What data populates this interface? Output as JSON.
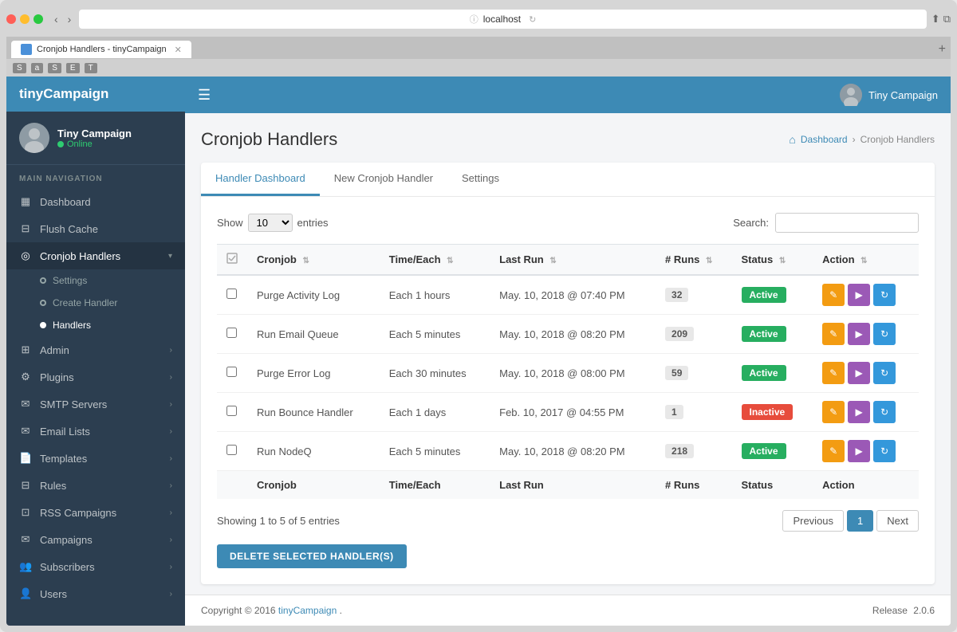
{
  "browser": {
    "url": "localhost",
    "tab_title": "Cronjob Handlers - tinyCampaign",
    "tab_label": "Cronjob Handlers - tinyCampaign"
  },
  "sidebar": {
    "logo_prefix": "tiny",
    "logo_suffix": "Campaign",
    "user": {
      "name": "Tiny Campaign",
      "status": "Online"
    },
    "nav_label": "Main Navigation",
    "items": [
      {
        "id": "dashboard",
        "icon": "▦",
        "label": "Dashboard"
      },
      {
        "id": "flush-cache",
        "icon": "⊟",
        "label": "Flush Cache"
      },
      {
        "id": "cronjob-handlers",
        "icon": "◎",
        "label": "Cronjob Handlers",
        "active": true,
        "has_arrow": true
      },
      {
        "id": "admin",
        "icon": "⊞",
        "label": "Admin",
        "has_arrow": true
      },
      {
        "id": "plugins",
        "icon": "⚙",
        "label": "Plugins",
        "has_arrow": true
      },
      {
        "id": "smtp-servers",
        "icon": "✉",
        "label": "SMTP Servers",
        "has_arrow": true
      },
      {
        "id": "email-lists",
        "icon": "✉",
        "label": "Email Lists",
        "has_arrow": true
      },
      {
        "id": "templates",
        "icon": "📄",
        "label": "Templates",
        "has_arrow": true
      },
      {
        "id": "rules",
        "icon": "⊟",
        "label": "Rules",
        "has_arrow": true
      },
      {
        "id": "rss-campaigns",
        "icon": "⊡",
        "label": "RSS Campaigns",
        "has_arrow": true
      },
      {
        "id": "campaigns",
        "icon": "✉",
        "label": "Campaigns",
        "has_arrow": true
      },
      {
        "id": "subscribers",
        "icon": "👥",
        "label": "Subscribers",
        "has_arrow": true
      },
      {
        "id": "users",
        "icon": "👤",
        "label": "Users",
        "has_arrow": true
      }
    ],
    "sub_items": [
      {
        "id": "settings",
        "label": "Settings",
        "filled": false
      },
      {
        "id": "create-handler",
        "label": "Create Handler",
        "filled": false
      },
      {
        "id": "handlers",
        "label": "Handlers",
        "active": true,
        "filled": true
      }
    ]
  },
  "topbar": {
    "user_name": "Tiny Campaign"
  },
  "page": {
    "title": "Cronjob Handlers",
    "breadcrumb": {
      "home": "Dashboard",
      "current": "Cronjob Handlers"
    },
    "tabs": [
      {
        "id": "handler-dashboard",
        "label": "Handler Dashboard",
        "active": true
      },
      {
        "id": "new-cronjob-handler",
        "label": "New Cronjob Handler",
        "active": false
      },
      {
        "id": "settings",
        "label": "Settings",
        "active": false
      }
    ],
    "table": {
      "show_label": "Show",
      "entries_label": "entries",
      "search_label": "Search:",
      "show_value": "10",
      "columns": [
        {
          "id": "cronjob",
          "label": "Cronjob"
        },
        {
          "id": "time-each",
          "label": "Time/Each"
        },
        {
          "id": "last-run",
          "label": "Last Run"
        },
        {
          "id": "num-runs",
          "label": "# Runs"
        },
        {
          "id": "status",
          "label": "Status"
        },
        {
          "id": "action",
          "label": "Action"
        }
      ],
      "rows": [
        {
          "id": "row1",
          "cronjob": "Purge Activity Log",
          "time_each": "Each 1 hours",
          "last_run": "May. 10, 2018 @ 07:40 PM",
          "num_runs": "32",
          "status": "Active",
          "status_type": "active"
        },
        {
          "id": "row2",
          "cronjob": "Run Email Queue",
          "time_each": "Each 5 minutes",
          "last_run": "May. 10, 2018 @ 08:20 PM",
          "num_runs": "209",
          "status": "Active",
          "status_type": "active"
        },
        {
          "id": "row3",
          "cronjob": "Purge Error Log",
          "time_each": "Each 30 minutes",
          "last_run": "May. 10, 2018 @ 08:00 PM",
          "num_runs": "59",
          "status": "Active",
          "status_type": "active"
        },
        {
          "id": "row4",
          "cronjob": "Run Bounce Handler",
          "time_each": "Each 1 days",
          "last_run": "Feb. 10, 2017 @ 04:55 PM",
          "num_runs": "1",
          "status": "Inactive",
          "status_type": "inactive"
        },
        {
          "id": "row5",
          "cronjob": "Run NodeQ",
          "time_each": "Each 5 minutes",
          "last_run": "May. 10, 2018 @ 08:20 PM",
          "num_runs": "218",
          "status": "Active",
          "status_type": "active"
        }
      ],
      "footer_cols": [
        "Cronjob",
        "Time/Each",
        "Last Run",
        "# Runs",
        "Status",
        "Action"
      ],
      "showing_text": "Showing 1 to 5 of 5 entries",
      "pagination": {
        "prev": "Previous",
        "next": "Next",
        "current": "1"
      },
      "delete_button": "Delete Selected Handler(s)"
    }
  },
  "footer": {
    "copyright": "Copyright © 2016",
    "brand": "tinyCampaign",
    "release_label": "Release",
    "release_version": "2.0.6"
  }
}
